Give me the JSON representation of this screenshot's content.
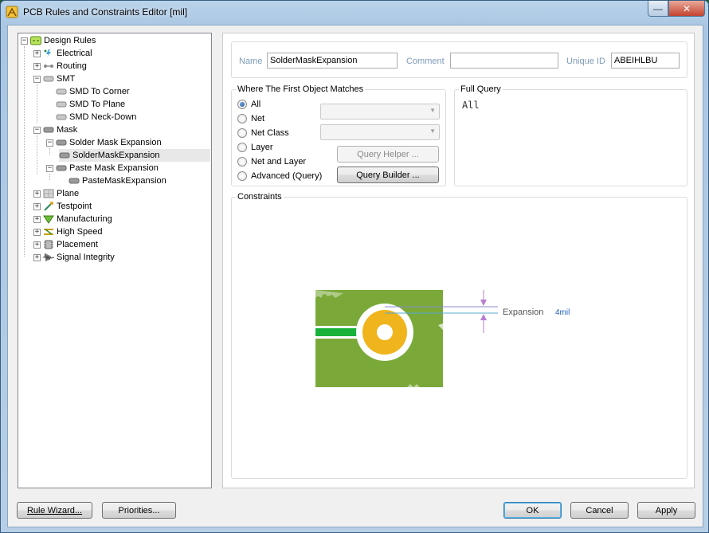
{
  "window": {
    "title": "PCB Rules and Constraints Editor [mil]",
    "minimize_glyph": "—",
    "close_glyph": "✕"
  },
  "tree": {
    "items": [
      {
        "label": "Design Rules",
        "icon": "design-rules-icon",
        "expander": "−"
      },
      {
        "label": "Electrical",
        "icon": "electrical-icon",
        "expander": "+"
      },
      {
        "label": "Routing",
        "icon": "routing-icon",
        "expander": "+"
      },
      {
        "label": "SMT",
        "icon": "smt-icon",
        "expander": "−"
      },
      {
        "label": "SMD To Corner",
        "icon": "smd-rule-icon",
        "expander": ""
      },
      {
        "label": "SMD To Plane",
        "icon": "smd-rule-icon",
        "expander": ""
      },
      {
        "label": "SMD Neck-Down",
        "icon": "smd-rule-icon",
        "expander": ""
      },
      {
        "label": "Mask",
        "icon": "mask-icon",
        "expander": "−"
      },
      {
        "label": "Solder Mask Expansion",
        "icon": "mask-rule-icon",
        "expander": "−"
      },
      {
        "label": "SolderMaskExpansion",
        "icon": "mask-rule-icon",
        "expander": ""
      },
      {
        "label": "Paste Mask Expansion",
        "icon": "mask-rule-icon",
        "expander": "−"
      },
      {
        "label": "PasteMaskExpansion",
        "icon": "mask-rule-icon",
        "expander": ""
      },
      {
        "label": "Plane",
        "icon": "plane-icon",
        "expander": "+"
      },
      {
        "label": "Testpoint",
        "icon": "testpoint-icon",
        "expander": "+"
      },
      {
        "label": "Manufacturing",
        "icon": "manufacturing-icon",
        "expander": "+"
      },
      {
        "label": "High Speed",
        "icon": "high-speed-icon",
        "expander": "+"
      },
      {
        "label": "Placement",
        "icon": "placement-icon",
        "expander": "+"
      },
      {
        "label": "Signal Integrity",
        "icon": "signal-integrity-icon",
        "expander": "+"
      }
    ]
  },
  "rule": {
    "name_label": "Name",
    "name_value": "SolderMaskExpansion",
    "comment_label": "Comment",
    "comment_value": "",
    "uid_label": "Unique ID",
    "uid_value": "ABEIHLBU"
  },
  "match": {
    "title": "Where The First Object Matches",
    "options": [
      "All",
      "Net",
      "Net Class",
      "Layer",
      "Net and Layer",
      "Advanced (Query)"
    ],
    "selected": "All",
    "query_helper": "Query Helper ...",
    "query_builder": "Query Builder ..."
  },
  "full_query": {
    "title": "Full Query",
    "text": "All"
  },
  "constraints": {
    "title": "Constraints",
    "expansion_label": "Expansion",
    "expansion_value": "4mil"
  },
  "buttons": {
    "rule_wizard": "Rule Wizard...",
    "priorities": "Priorities...",
    "ok": "OK",
    "cancel": "Cancel",
    "apply": "Apply"
  },
  "colors": {
    "board_green": "#7aa93a",
    "pad_yellow": "#f0b41c",
    "trace_green": "#18b23b",
    "dimension_purple": "#b77fd0",
    "value_blue": "#1f5fbf"
  }
}
